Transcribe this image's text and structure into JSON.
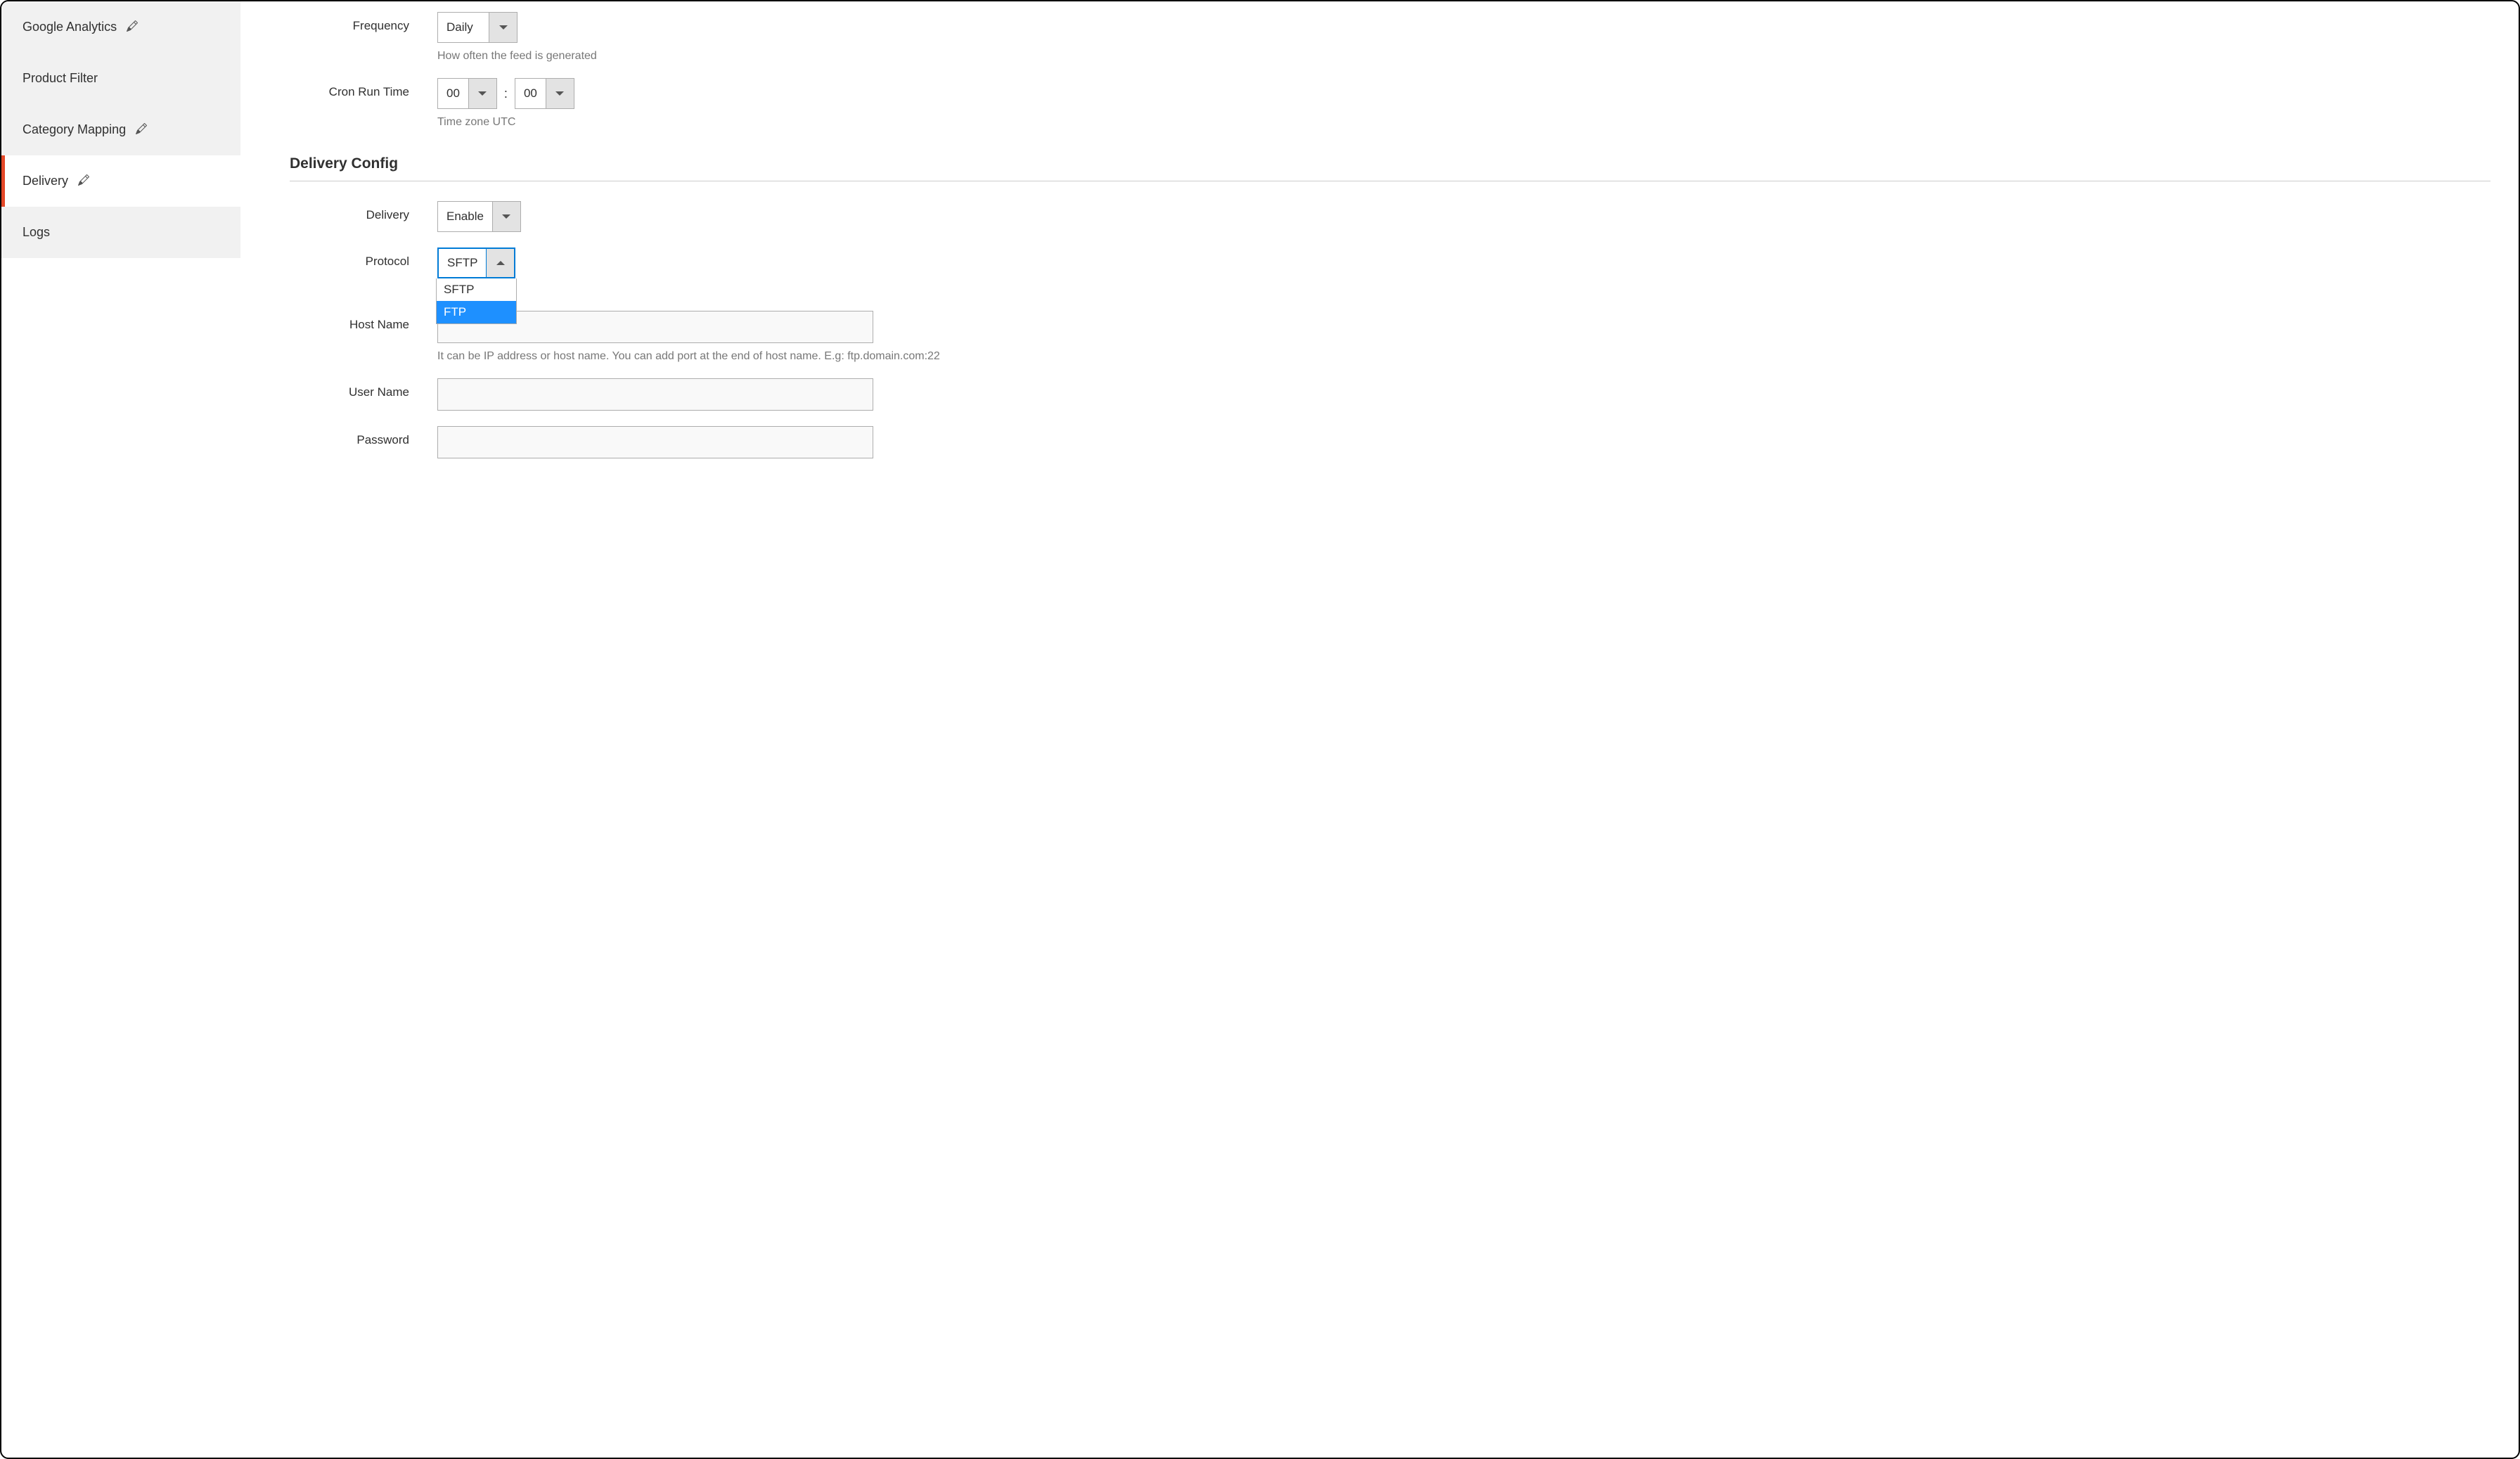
{
  "sidebar": {
    "items": [
      {
        "label": "Google Analytics",
        "editable": true,
        "active": false
      },
      {
        "label": "Product Filter",
        "editable": false,
        "active": false
      },
      {
        "label": "Category Mapping",
        "editable": true,
        "active": false
      },
      {
        "label": "Delivery",
        "editable": true,
        "active": true
      },
      {
        "label": "Logs",
        "editable": false,
        "active": false
      }
    ]
  },
  "form": {
    "frequency": {
      "label": "Frequency",
      "value": "Daily",
      "hint": "How often the feed is generated"
    },
    "cronRunTime": {
      "label": "Cron Run Time",
      "hour": "00",
      "minute": "00",
      "separator": ":",
      "hint": "Time zone UTC"
    }
  },
  "deliverySection": {
    "title": "Delivery Config",
    "delivery": {
      "label": "Delivery",
      "value": "Enable"
    },
    "protocol": {
      "label": "Protocol",
      "value": "SFTP",
      "options": [
        "SFTP",
        "FTP"
      ],
      "hoveredOption": "FTP"
    },
    "hostName": {
      "label": "Host Name",
      "value": "",
      "hint": "It can be IP address or host name. You can add port at the end of host name. E.g: ftp.domain.com:22"
    },
    "userName": {
      "label": "User Name",
      "value": ""
    },
    "password": {
      "label": "Password",
      "value": ""
    }
  }
}
